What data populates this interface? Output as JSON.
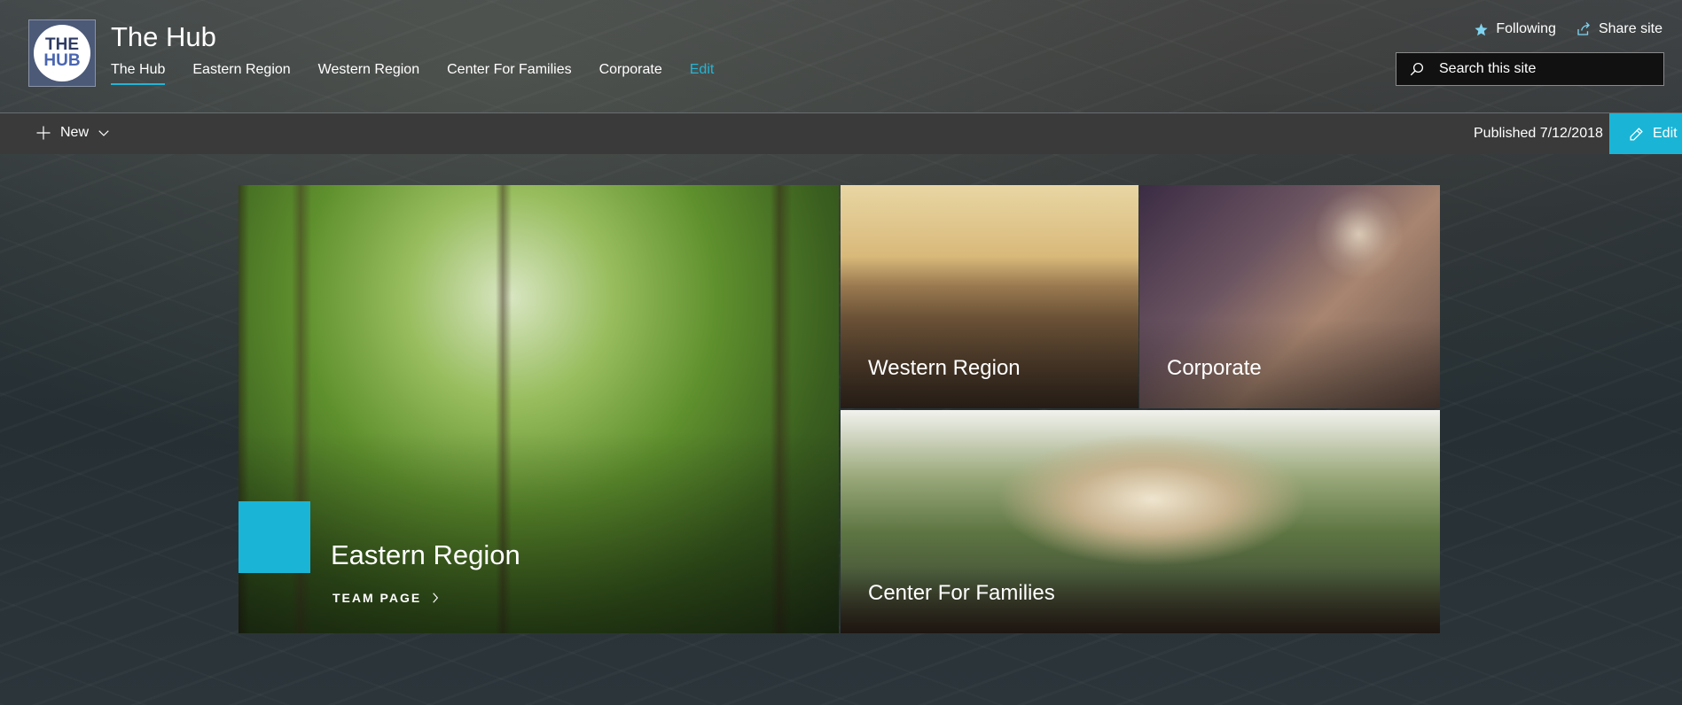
{
  "site": {
    "logo_top": "THE",
    "logo_bottom": "HUB",
    "title": "The Hub"
  },
  "nav": {
    "items": [
      {
        "label": "The Hub",
        "active": true
      },
      {
        "label": "Eastern Region"
      },
      {
        "label": "Western Region"
      },
      {
        "label": "Center For Families"
      },
      {
        "label": "Corporate"
      }
    ],
    "edit_label": "Edit"
  },
  "top_actions": {
    "following_label": "Following",
    "share_label": "Share site"
  },
  "search": {
    "placeholder": "Search this site"
  },
  "command_bar": {
    "new_label": "New",
    "published_text": "Published 7/12/2018",
    "edit_label": "Edit"
  },
  "tiles": {
    "eastern": {
      "title": "Eastern Region",
      "link_label": "TEAM PAGE"
    },
    "western": {
      "title": "Western Region"
    },
    "corporate": {
      "title": "Corporate"
    },
    "families": {
      "title": "Center For Families"
    }
  },
  "colors": {
    "accent": "#1ab5d6",
    "command_bar": "#3a3a3a"
  },
  "icons": [
    "star-icon",
    "share-icon",
    "search-icon",
    "plus-icon",
    "chevron-down-icon",
    "pencil-icon",
    "chevron-right-icon"
  ]
}
